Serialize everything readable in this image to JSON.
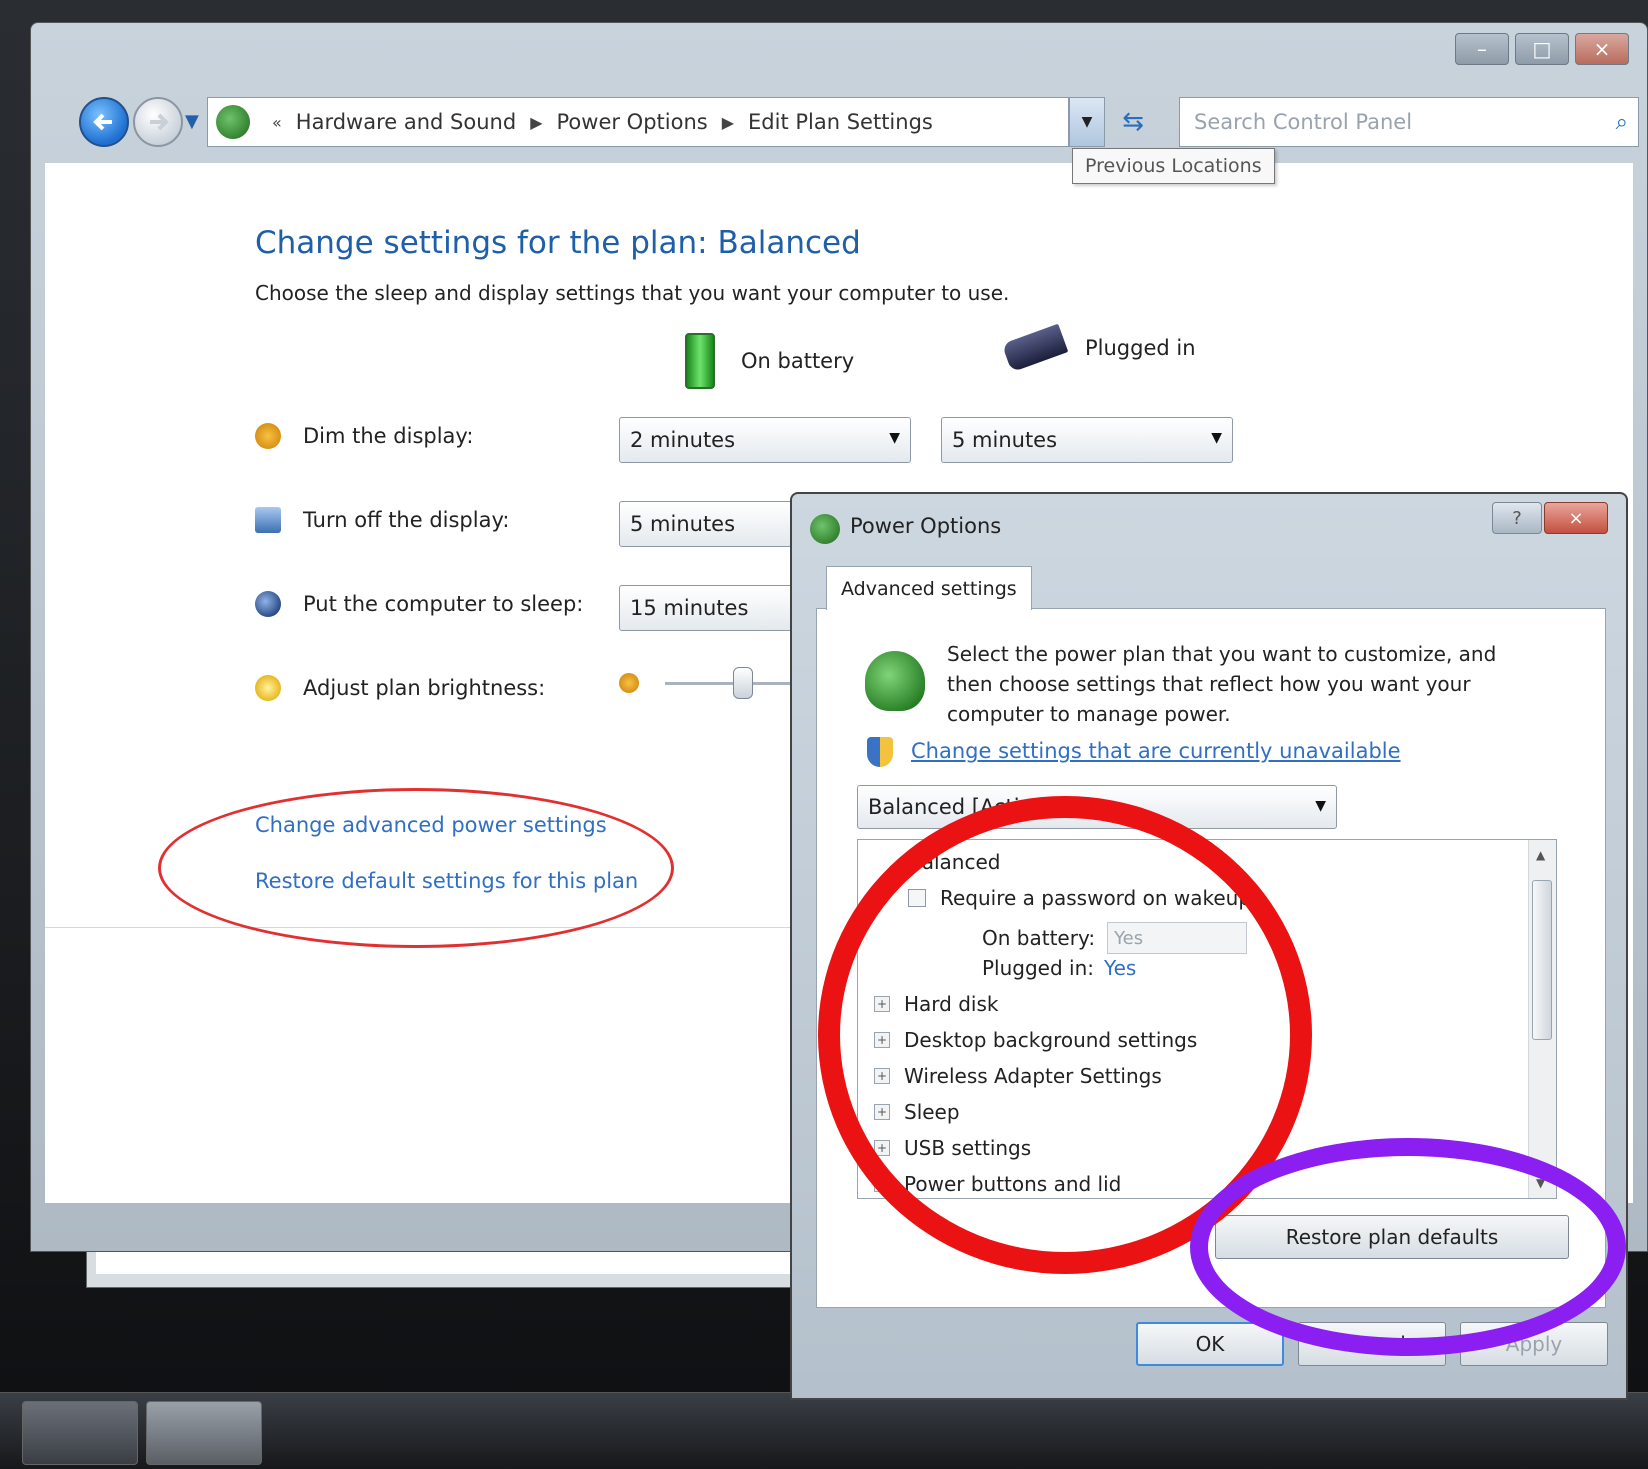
{
  "window": {
    "minimize": "–",
    "maximize": "□",
    "close": "×"
  },
  "nav": {
    "crumbs": [
      "Hardware and Sound",
      "Power Options",
      "Edit Plan Settings"
    ],
    "crumb_overflow": "«",
    "search_placeholder": "Search Control Panel",
    "tooltip": "Previous Locations"
  },
  "page": {
    "title": "Change settings for the plan: Balanced",
    "subtitle": "Choose the sleep and display settings that you want your computer to use.",
    "col_battery": "On battery",
    "col_plugged": "Plugged in",
    "rows": {
      "dim": {
        "label": "Dim the display:",
        "battery": "2 minutes",
        "plugged": "5 minutes"
      },
      "turnoff": {
        "label": "Turn off the display:",
        "battery": "5 minutes"
      },
      "sleep": {
        "label": "Put the computer to sleep:",
        "battery": "15 minutes"
      },
      "brightness": {
        "label": "Adjust plan brightness:"
      }
    },
    "links": {
      "advanced": "Change advanced power settings",
      "restore": "Restore default settings for this plan"
    }
  },
  "dialog": {
    "title": "Power Options",
    "help": "?",
    "close": "×",
    "tab": "Advanced settings",
    "description": "Select the power plan that you want to customize, and then choose settings that reflect how you want your computer to manage power.",
    "unavailable_link": "Change settings that are currently unavailable",
    "plan_select": "Balanced [Active]",
    "tree": {
      "balanced": "Balanced",
      "password": "Require a password on wakeup",
      "on_battery_label": "On battery:",
      "on_battery_value": "Yes",
      "plugged_label": "Plugged in:",
      "plugged_value": "Yes",
      "hard_disk": "Hard disk",
      "desktop": "Desktop background settings",
      "wireless": "Wireless Adapter Settings",
      "sleep": "Sleep",
      "usb": "USB settings",
      "power_buttons": "Power buttons and lid"
    },
    "restore_button": "Restore plan defaults",
    "ok": "OK",
    "cancel": "Cancel",
    "apply": "Apply"
  },
  "colors": {
    "link": "#2f6fc4",
    "title": "#1f5fa8",
    "annotation_red": "#ea1212",
    "annotation_purple": "#8b1ff2"
  }
}
